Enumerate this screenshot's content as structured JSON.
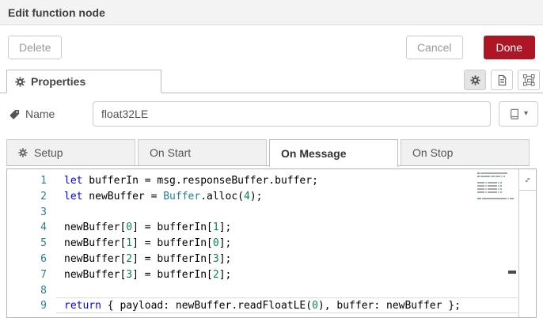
{
  "window": {
    "title": "Edit function node"
  },
  "toolbar": {
    "delete_label": "Delete",
    "cancel_label": "Cancel",
    "done_label": "Done"
  },
  "properties_bar": {
    "tab_label": "Properties",
    "icon_buttons": [
      {
        "name": "properties-gear",
        "icon": "gear-icon",
        "active": true
      },
      {
        "name": "description",
        "icon": "document-icon",
        "active": false
      },
      {
        "name": "appearance",
        "icon": "node-appearance-icon",
        "active": false
      }
    ]
  },
  "name_field": {
    "icon": "tag-icon",
    "label": "Name",
    "value": "float32LE",
    "library_icon": "book-icon"
  },
  "function_tabs": [
    {
      "label": "Setup",
      "icon": "gear-icon",
      "active": false
    },
    {
      "label": "On Start",
      "active": false
    },
    {
      "label": "On Message",
      "active": true
    },
    {
      "label": "On Stop",
      "active": false
    }
  ],
  "editor": {
    "current_line": 9,
    "expand_icon": "expand-icon",
    "lines": [
      {
        "number": 1,
        "tokens": [
          [
            "kw",
            "let"
          ],
          [
            "plain",
            " bufferIn = msg.responseBuffer.buffer;"
          ]
        ]
      },
      {
        "number": 2,
        "tokens": [
          [
            "kw",
            "let"
          ],
          [
            "plain",
            " newBuffer = "
          ],
          [
            "type",
            "Buffer"
          ],
          [
            "plain",
            ".alloc("
          ],
          [
            "num",
            "4"
          ],
          [
            "plain",
            ");"
          ]
        ]
      },
      {
        "number": 3,
        "tokens": []
      },
      {
        "number": 4,
        "tokens": [
          [
            "plain",
            "newBuffer["
          ],
          [
            "num",
            "0"
          ],
          [
            "plain",
            "] = bufferIn["
          ],
          [
            "num",
            "1"
          ],
          [
            "plain",
            "];"
          ]
        ]
      },
      {
        "number": 5,
        "tokens": [
          [
            "plain",
            "newBuffer["
          ],
          [
            "num",
            "1"
          ],
          [
            "plain",
            "] = bufferIn["
          ],
          [
            "num",
            "0"
          ],
          [
            "plain",
            "];"
          ]
        ]
      },
      {
        "number": 6,
        "tokens": [
          [
            "plain",
            "newBuffer["
          ],
          [
            "num",
            "2"
          ],
          [
            "plain",
            "] = bufferIn["
          ],
          [
            "num",
            "3"
          ],
          [
            "plain",
            "];"
          ]
        ]
      },
      {
        "number": 7,
        "tokens": [
          [
            "plain",
            "newBuffer["
          ],
          [
            "num",
            "3"
          ],
          [
            "plain",
            "] = bufferIn["
          ],
          [
            "num",
            "2"
          ],
          [
            "plain",
            "];"
          ]
        ]
      },
      {
        "number": 8,
        "tokens": []
      },
      {
        "number": 9,
        "tokens": [
          [
            "kw",
            "return"
          ],
          [
            "plain",
            " { payload: newBuffer.readFloatLE("
          ],
          [
            "num",
            "0"
          ],
          [
            "plain",
            "), buffer: newBuffer };"
          ]
        ]
      }
    ]
  },
  "colors": {
    "done_button_bg": "#AD1625",
    "keyword": "#0000ff",
    "type": "#267f99",
    "number": "#098658",
    "line_number": "#2e7d96"
  }
}
